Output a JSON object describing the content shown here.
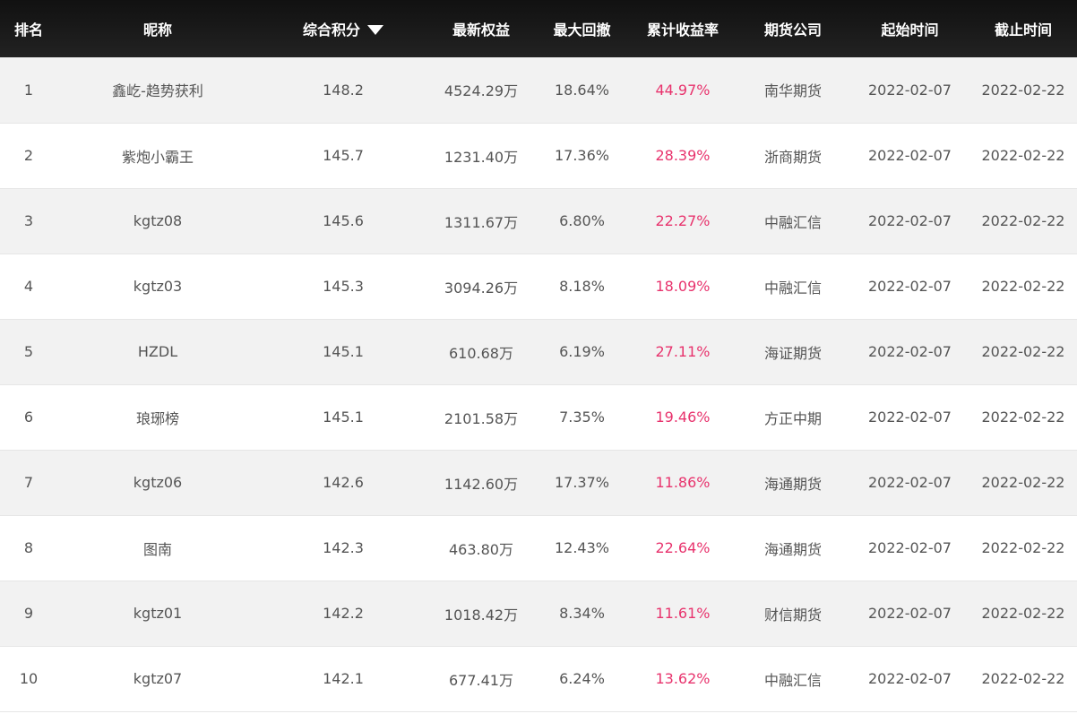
{
  "table": {
    "headers": {
      "rank": "排名",
      "nickname": "昵称",
      "score": "综合积分",
      "equity": "最新权益",
      "drawdown": "最大回撤",
      "return_rate": "累计收益率",
      "company": "期货公司",
      "start": "起始时间",
      "end": "截止时间"
    },
    "sort_icon": "caret-down-icon",
    "accent_color": "#e8336d",
    "rows": [
      {
        "rank": "1",
        "nickname": "鑫屹-趋势获利",
        "score": "148.2",
        "equity": "4524.29万",
        "drawdown": "18.64%",
        "return_rate": "44.97%",
        "company": "南华期货",
        "start": "2022-02-07",
        "end": "2022-02-22"
      },
      {
        "rank": "2",
        "nickname": "紫炮小霸王",
        "score": "145.7",
        "equity": "1231.40万",
        "drawdown": "17.36%",
        "return_rate": "28.39%",
        "company": "浙商期货",
        "start": "2022-02-07",
        "end": "2022-02-22"
      },
      {
        "rank": "3",
        "nickname": "kgtz08",
        "score": "145.6",
        "equity": "1311.67万",
        "drawdown": "6.80%",
        "return_rate": "22.27%",
        "company": "中融汇信",
        "start": "2022-02-07",
        "end": "2022-02-22"
      },
      {
        "rank": "4",
        "nickname": "kgtz03",
        "score": "145.3",
        "equity": "3094.26万",
        "drawdown": "8.18%",
        "return_rate": "18.09%",
        "company": "中融汇信",
        "start": "2022-02-07",
        "end": "2022-02-22"
      },
      {
        "rank": "5",
        "nickname": "HZDL",
        "score": "145.1",
        "equity": "610.68万",
        "drawdown": "6.19%",
        "return_rate": "27.11%",
        "company": "海证期货",
        "start": "2022-02-07",
        "end": "2022-02-22"
      },
      {
        "rank": "6",
        "nickname": "琅琊榜",
        "score": "145.1",
        "equity": "2101.58万",
        "drawdown": "7.35%",
        "return_rate": "19.46%",
        "company": "方正中期",
        "start": "2022-02-07",
        "end": "2022-02-22"
      },
      {
        "rank": "7",
        "nickname": "kgtz06",
        "score": "142.6",
        "equity": "1142.60万",
        "drawdown": "17.37%",
        "return_rate": "11.86%",
        "company": "海通期货",
        "start": "2022-02-07",
        "end": "2022-02-22"
      },
      {
        "rank": "8",
        "nickname": "图南",
        "score": "142.3",
        "equity": "463.80万",
        "drawdown": "12.43%",
        "return_rate": "22.64%",
        "company": "海通期货",
        "start": "2022-02-07",
        "end": "2022-02-22"
      },
      {
        "rank": "9",
        "nickname": "kgtz01",
        "score": "142.2",
        "equity": "1018.42万",
        "drawdown": "8.34%",
        "return_rate": "11.61%",
        "company": "财信期货",
        "start": "2022-02-07",
        "end": "2022-02-22"
      },
      {
        "rank": "10",
        "nickname": "kgtz07",
        "score": "142.1",
        "equity": "677.41万",
        "drawdown": "6.24%",
        "return_rate": "13.62%",
        "company": "中融汇信",
        "start": "2022-02-07",
        "end": "2022-02-22"
      }
    ]
  }
}
